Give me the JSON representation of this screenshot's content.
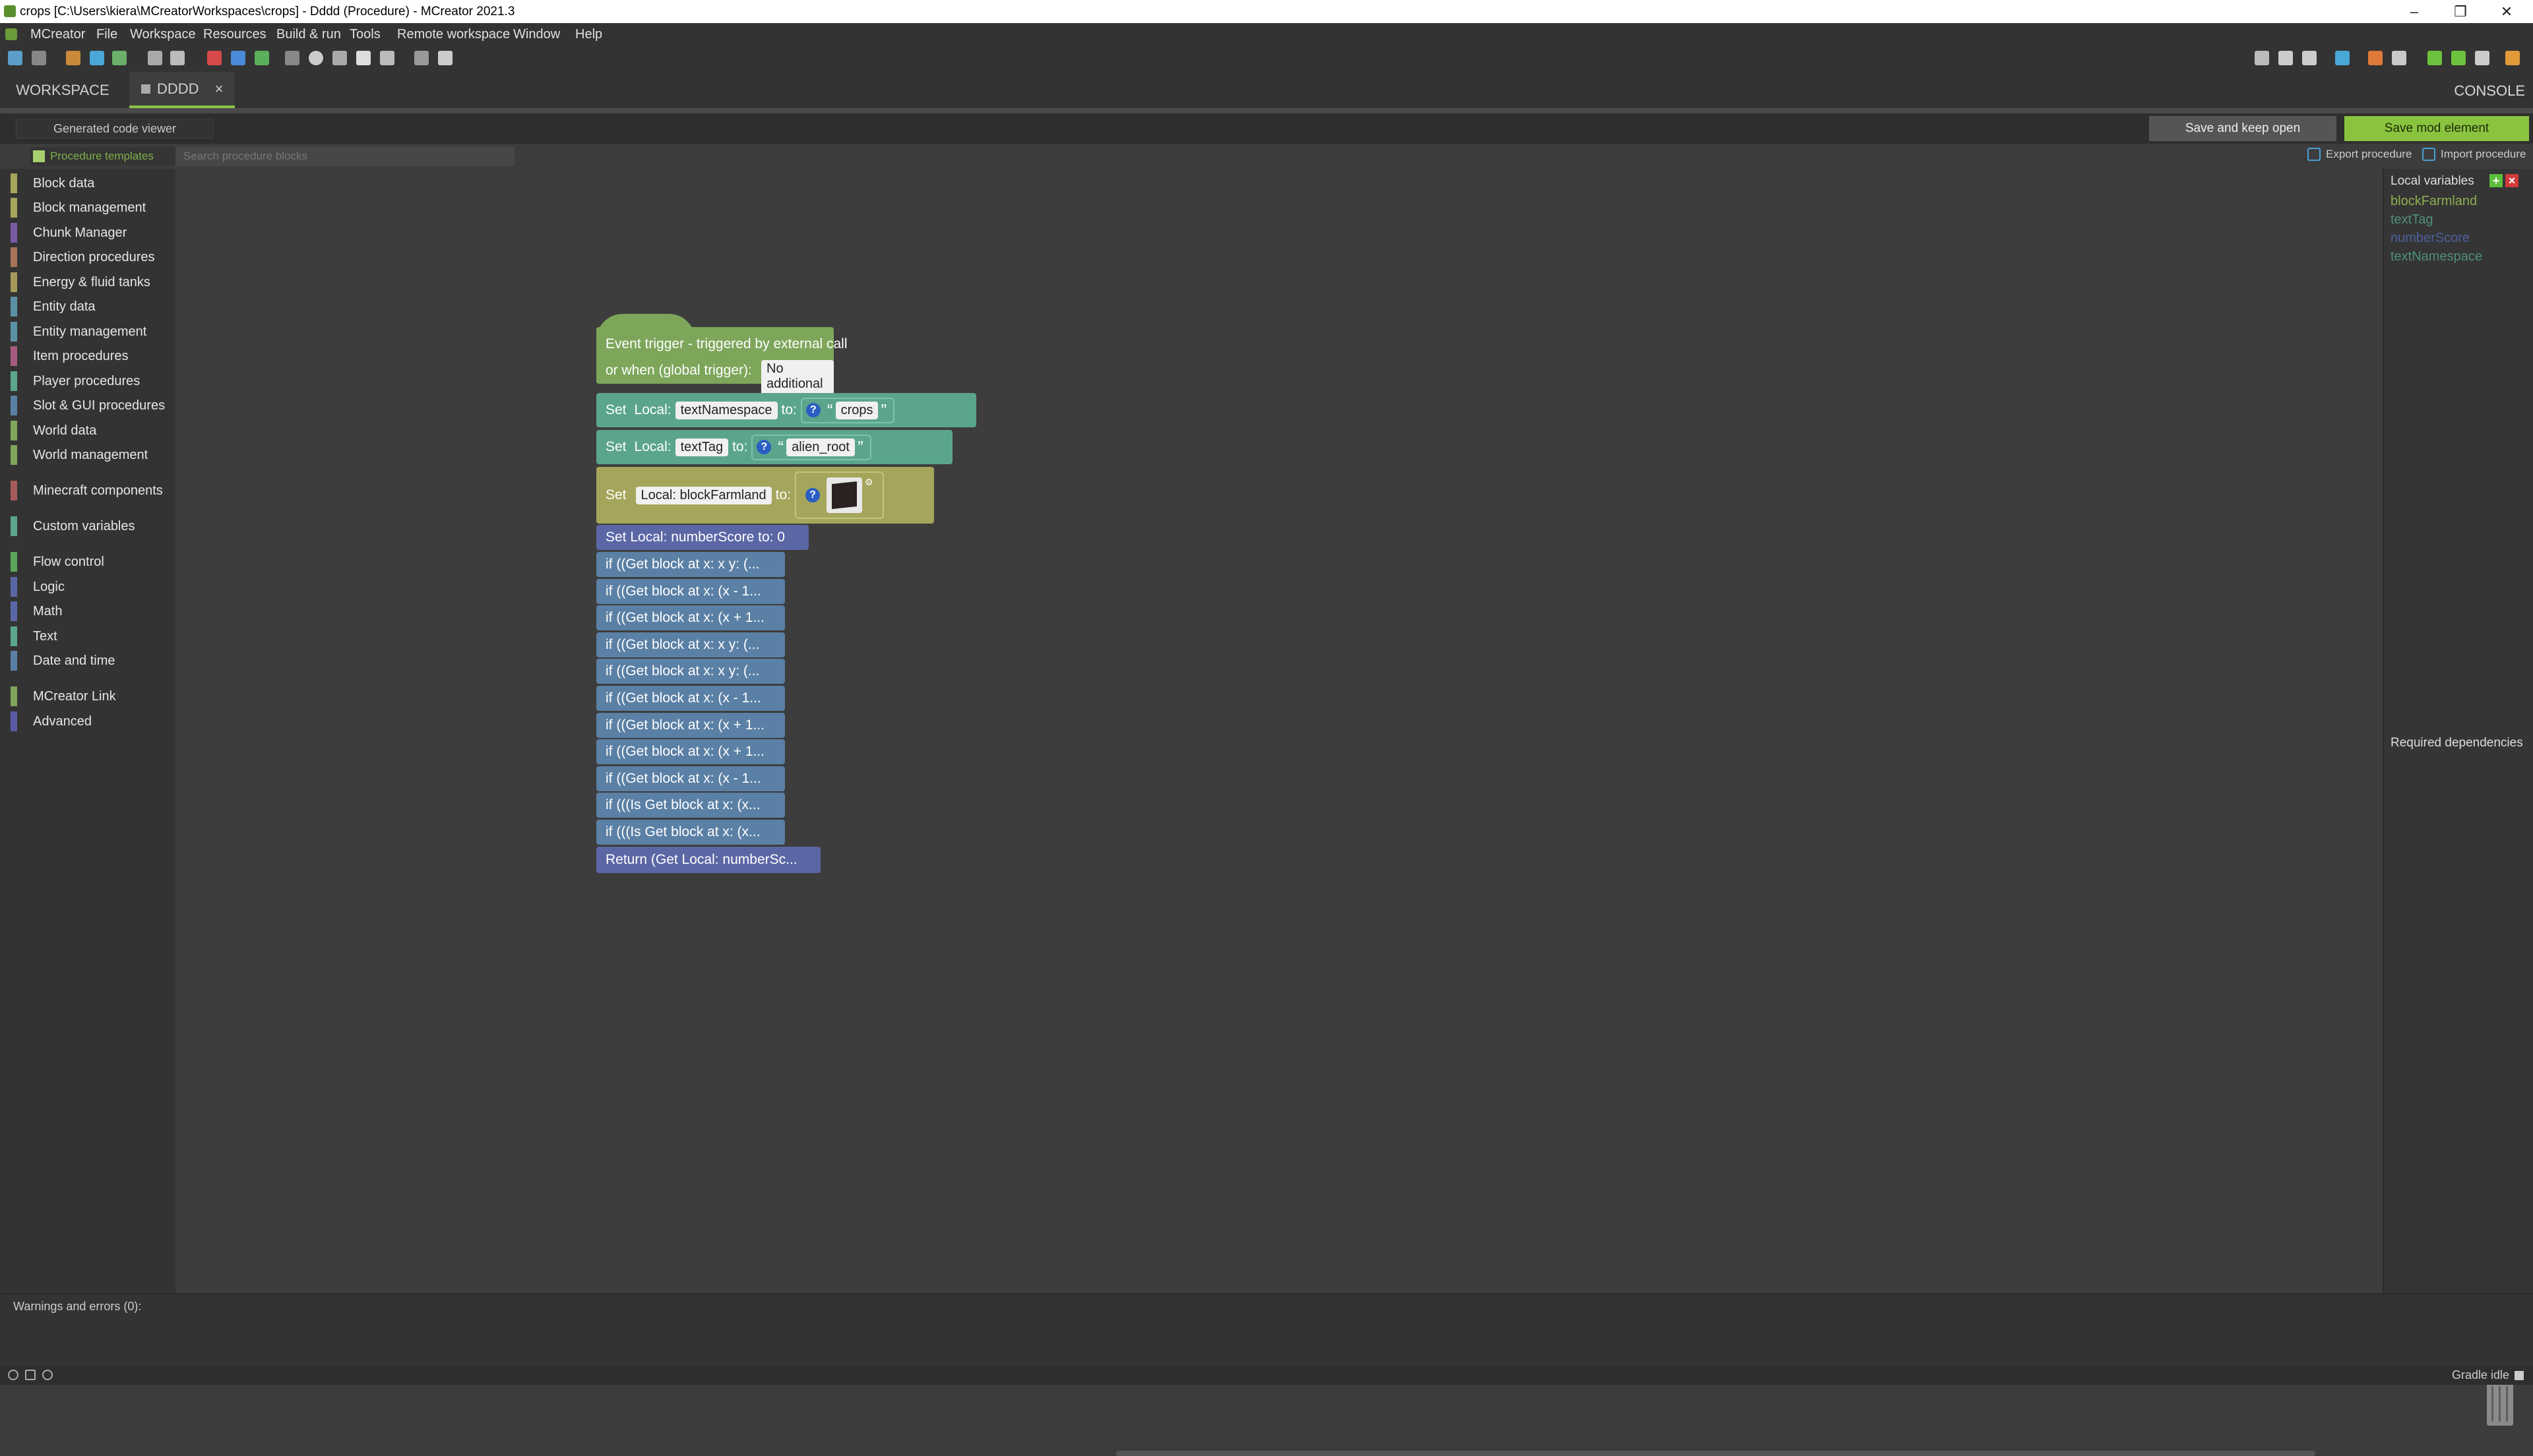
{
  "window": {
    "title": "crops [C:\\Users\\kiera\\MCreatorWorkspaces\\crops] - Dddd (Procedure) - MCreator 2021.3"
  },
  "menu": [
    "MCreator",
    "File",
    "Workspace",
    "Resources",
    "Build & run",
    "Tools",
    "Remote workspace",
    "Window",
    "Help"
  ],
  "tabs": {
    "workspace": "WORKSPACE",
    "dddd": "DDDD",
    "close": "×",
    "console": "CONSOLE"
  },
  "actions": {
    "generated_code": "Generated code viewer",
    "save_keep": "Save and keep open",
    "save_mod": "Save mod element"
  },
  "search": {
    "templates": "Procedure templates",
    "placeholder": "Search procedure blocks",
    "export": "Export procedure",
    "import": "Import procedure"
  },
  "categories": [
    {
      "label": "Block data",
      "color": "#a5a55b"
    },
    {
      "label": "Block management",
      "color": "#a5a55b"
    },
    {
      "label": "Chunk Manager",
      "color": "#7a5ba5"
    },
    {
      "label": "Direction procedures",
      "color": "#a5745b"
    },
    {
      "label": "Energy & fluid tanks",
      "color": "#a59a5b"
    },
    {
      "label": "Entity data",
      "color": "#5b91a5"
    },
    {
      "label": "Entity management",
      "color": "#5b91a5"
    },
    {
      "label": "Item procedures",
      "color": "#a55b80"
    },
    {
      "label": "Player procedures",
      "color": "#5ba58c"
    },
    {
      "label": "Slot & GUI procedures",
      "color": "#5b80a5"
    },
    {
      "label": "World data",
      "color": "#80a55b"
    },
    {
      "label": "World management",
      "color": "#80a55b"
    },
    {
      "label": "Minecraft components",
      "color": "#a55b5b"
    },
    {
      "label": "Custom variables",
      "color": "#5ba58c"
    },
    {
      "label": "Flow control",
      "color": "#5ba55b"
    },
    {
      "label": "Logic",
      "color": "#5b67a5"
    },
    {
      "label": "Math",
      "color": "#5b67a5"
    },
    {
      "label": "Text",
      "color": "#5ba58c"
    },
    {
      "label": "Date and time",
      "color": "#5b80a5"
    },
    {
      "label": "MCreator Link",
      "color": "#80a55b"
    },
    {
      "label": "Advanced",
      "color": "#5b5ba5"
    }
  ],
  "blocks": {
    "trigger_line1": "Event trigger - triggered by external call",
    "trigger_line2": "or when (global trigger):",
    "trigger_value": "No additional trigger",
    "set": "Set",
    "local": "Local:",
    "to": "to:",
    "s1_var": "textNamespace",
    "s1_value": "crops",
    "s2_var": "textTag",
    "s2_value": "alien_root",
    "s3_var": "Local: blockFarmland",
    "set_number": "Set Local: numberScore to: 0",
    "qmark": "?",
    "ifs": [
      "if ((Get block at x: x y: (...",
      "if ((Get block at x: (x - 1...",
      "if ((Get block at x: (x + 1...",
      "if ((Get block at x: x y: (...",
      "if ((Get block at x: x y: (...",
      "if ((Get block at x: (x - 1...",
      "if ((Get block at x: (x + 1...",
      "if ((Get block at x: (x + 1...",
      "if ((Get block at x: (x - 1...",
      "if (((Is Get block at x: (x...",
      "if (((Is Get block at x: (x..."
    ],
    "return": "Return (Get Local: numberSc..."
  },
  "local_vars": {
    "title": "Local variables",
    "add": "+",
    "remove": "×",
    "items": [
      {
        "name": "blockFarmland",
        "color": "#8fae4e"
      },
      {
        "name": "textTag",
        "color": "#4e8e7a"
      },
      {
        "name": "numberScore",
        "color": "#4e5fa0"
      },
      {
        "name": "textNamespace",
        "color": "#4e8e7a"
      }
    ]
  },
  "required_deps": "Required dependencies",
  "warnings": "Warnings and errors (0):",
  "status": "Gradle idle"
}
